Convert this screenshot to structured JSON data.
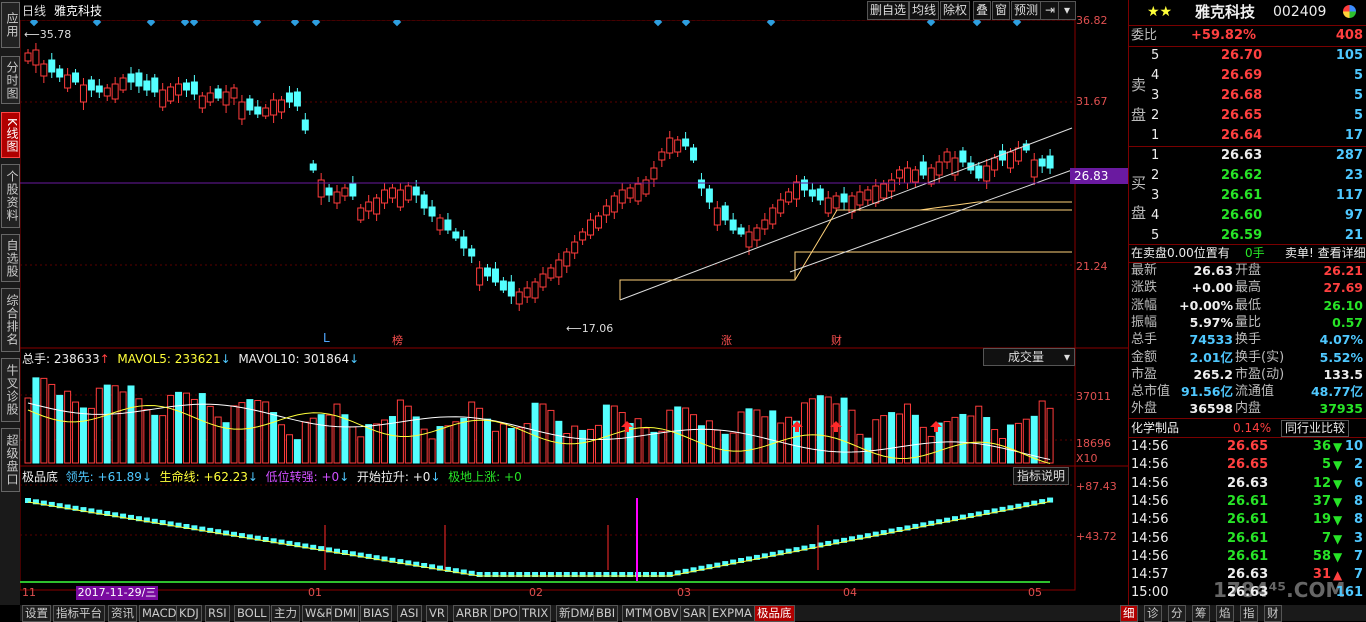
{
  "left_tabs": [
    "应用",
    "分时图",
    "K线图",
    "个股资料",
    "自选股",
    "综合排名",
    "牛叉诊股",
    "超级盘口"
  ],
  "topbar": {
    "period": "日线",
    "stock_name": "雅克科技",
    "buttons": [
      "删自选",
      "均线",
      "除权",
      "叠",
      "窗",
      "预测"
    ]
  },
  "price_axis": [
    "36.82",
    "31.67",
    "26.83",
    "21.24"
  ],
  "current_price_tag": "26.83",
  "hi_label": "35.78",
  "lo_label": "17.06",
  "markers": [
    "L",
    "榜",
    "涨",
    "财"
  ],
  "volume": {
    "total_label": "总手: 238633",
    "mavol5": "MAVOL5: 233621",
    "mavol10": "MAVOL10: 301864",
    "dropdown": "成交量",
    "axis": [
      "37011",
      "18696",
      "X10"
    ]
  },
  "indicator": {
    "title": "极品底",
    "lead": "领先: +61.89",
    "life": "生命线: +62.23",
    "low": "低位转强: +0",
    "start": "开始拉升: +0",
    "bottom": "极地上涨: +0",
    "explain_btn": "指标说明",
    "axis": [
      "+87.43",
      "+43.72"
    ]
  },
  "date_axis": [
    "11",
    "01",
    "02",
    "03",
    "04",
    "05"
  ],
  "cursor_date": "2017-11-29/三",
  "quote": {
    "name": "雅克科技",
    "code": "002409",
    "weibi_label": "委比",
    "weibi_pct": "+59.82%",
    "weibi_val": "408",
    "sell_label": "卖盘",
    "buy_label": "买盘",
    "sell": [
      [
        "5",
        "26.70",
        "105"
      ],
      [
        "4",
        "26.69",
        "5"
      ],
      [
        "3",
        "26.68",
        "5"
      ],
      [
        "2",
        "26.65",
        "5"
      ],
      [
        "1",
        "26.64",
        "17"
      ]
    ],
    "buy": [
      [
        "1",
        "26.63",
        "287"
      ],
      [
        "2",
        "26.62",
        "23"
      ],
      [
        "3",
        "26.61",
        "117"
      ],
      [
        "4",
        "26.60",
        "97"
      ],
      [
        "5",
        "26.59",
        "21"
      ]
    ],
    "info_left": "在卖盘0.00位置有",
    "info_mid": "0手",
    "info_right": "卖单! 查看详细",
    "stats": [
      [
        "最新",
        "26.63",
        "开盘",
        "26.21"
      ],
      [
        "涨跌",
        "+0.00",
        "最高",
        "27.69"
      ],
      [
        "涨幅",
        "+0.00%",
        "最低",
        "26.10"
      ],
      [
        "振幅",
        "5.97%",
        "量比",
        "0.57"
      ],
      [
        "总手",
        "74533",
        "换手",
        "4.07%"
      ],
      [
        "金额",
        "2.01亿",
        "换手(实)",
        "5.52%"
      ],
      [
        "市盈",
        "265.2",
        "市盈(动)",
        "133.5"
      ],
      [
        "总市值",
        "91.56亿",
        "流通值",
        "48.77亿"
      ],
      [
        "外盘",
        "36598",
        "内盘",
        "37935"
      ]
    ],
    "industry": "化学制品",
    "industry_pct": "0.14%",
    "industry_btn": "同行业比较",
    "ticks": [
      [
        "14:56",
        "26.65",
        "36",
        "10"
      ],
      [
        "14:56",
        "26.65",
        "5",
        "2"
      ],
      [
        "14:56",
        "26.63",
        "12",
        "6"
      ],
      [
        "14:56",
        "26.61",
        "37",
        "8"
      ],
      [
        "14:56",
        "26.61",
        "19",
        "8"
      ],
      [
        "14:56",
        "26.61",
        "7",
        "3"
      ],
      [
        "14:56",
        "26.61",
        "58",
        "7"
      ],
      [
        "14:57",
        "26.63",
        "31",
        "7"
      ],
      [
        "15:00",
        "26.63",
        "",
        "161"
      ]
    ],
    "watermark": "1784⁴⁵.COM"
  },
  "bottom_tabs": [
    "设置",
    "指标平台",
    "资讯",
    "MACD",
    "KDJ",
    "RSI",
    "BOLL",
    "主力",
    "W&R",
    "DMI",
    "BIAS",
    "ASI",
    "VR",
    "ARBR",
    "DPO",
    "TRIX",
    "新DMA",
    "BBI",
    "MTM",
    "OBV",
    "SAR",
    "EXPMA",
    "极品底"
  ],
  "right_bottom_tabs": [
    "细",
    "诊",
    "分",
    "筹",
    "焰",
    "指",
    "财"
  ],
  "colors": {
    "up": "#ff3c3c",
    "down": "#54ffff",
    "panel_border": "#7a0000",
    "accent": "#ffff3a"
  }
}
